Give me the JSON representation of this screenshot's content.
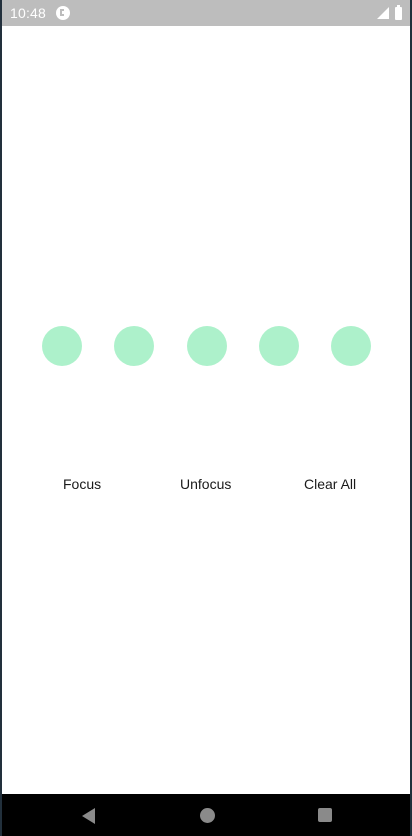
{
  "status_bar": {
    "time": "10:48",
    "app_icon": "pocket-casts-style-notification-icon",
    "signal_icon": "cellular-signal-icon",
    "battery_icon": "battery-icon",
    "background_color": "#bdbdbd"
  },
  "otp": {
    "cell_count": 5,
    "cell_color": "#adf1cb"
  },
  "actions": {
    "focus_label": "Focus",
    "unfocus_label": "Unfocus",
    "clear_all_label": "Clear All"
  },
  "nav_bar": {
    "back_icon": "back-triangle-icon",
    "home_icon": "home-circle-icon",
    "recents_icon": "recents-square-icon"
  }
}
